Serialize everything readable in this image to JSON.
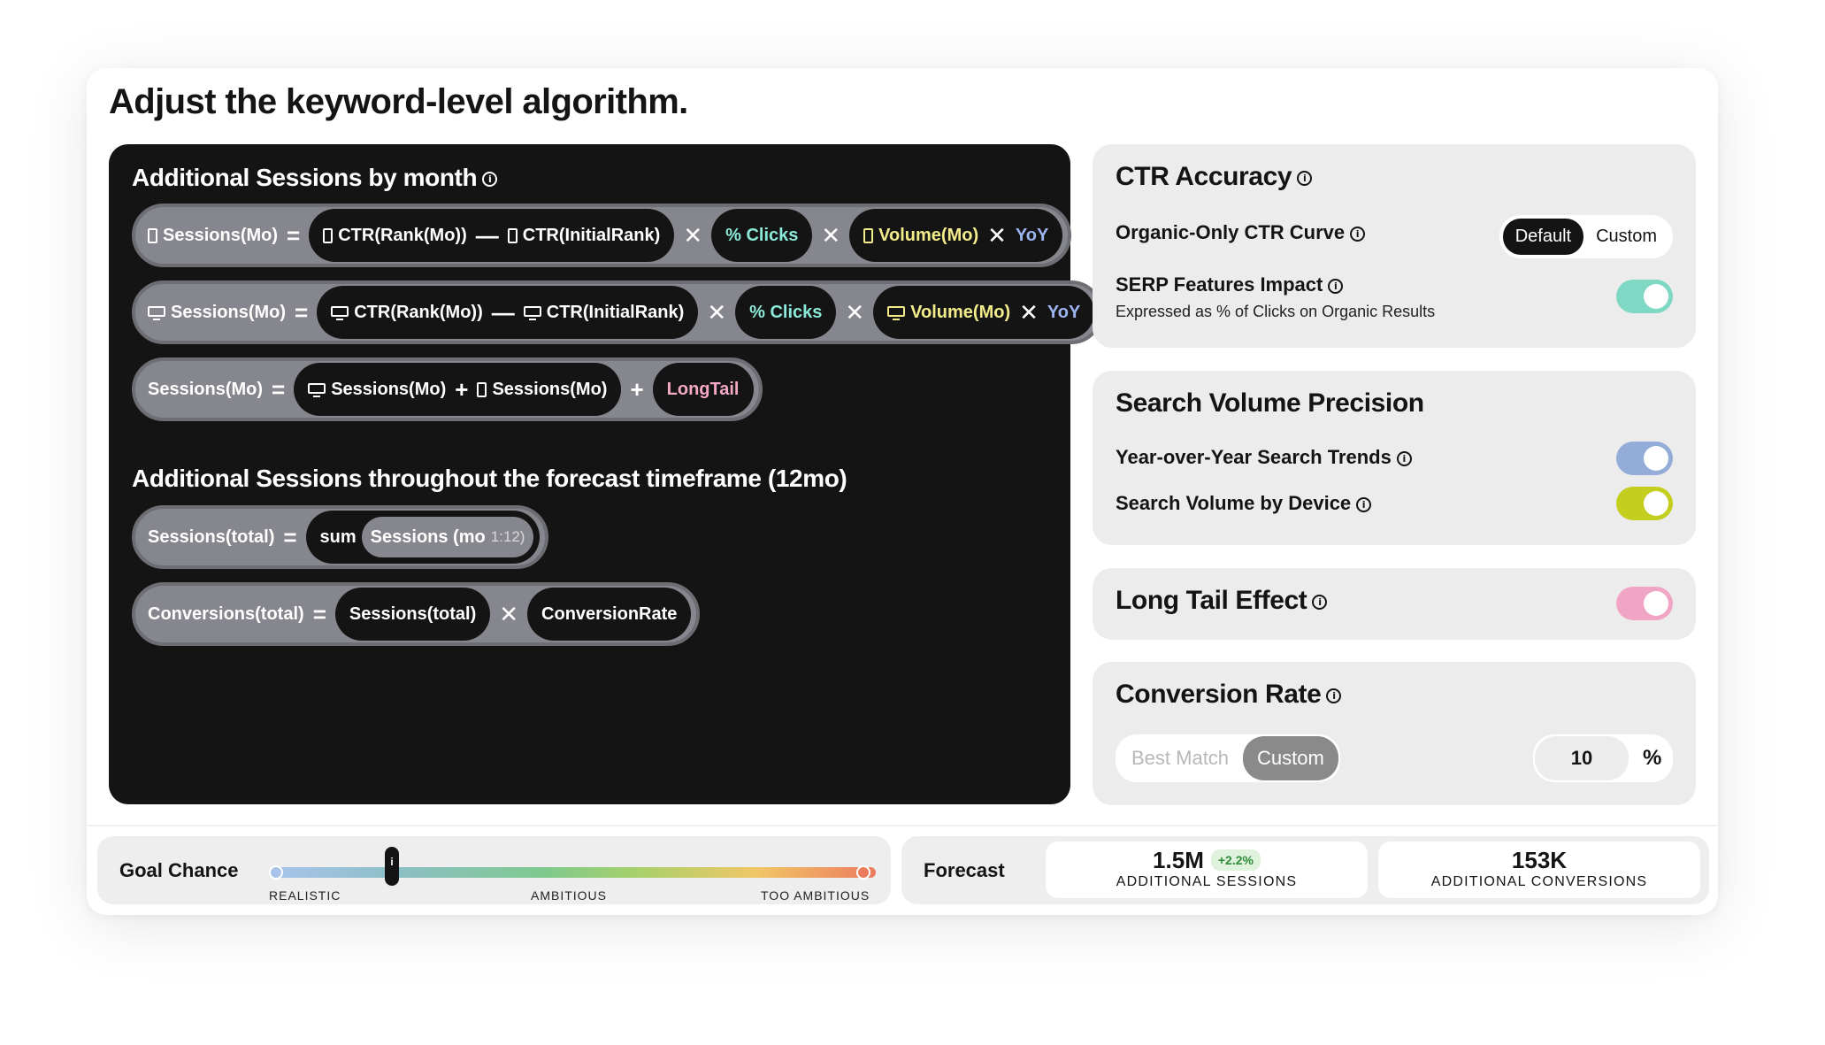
{
  "title": "Adjust the keyword-level algorithm.",
  "left_panel": {
    "monthly_heading": "Additional Sessions by month",
    "f1": {
      "lhs": "Sessions(Mo)",
      "eq": "=",
      "t1": "CTR(Rank(Mo))",
      "minus": "—",
      "t2": "CTR(InitialRank)",
      "x1": "✕",
      "clicks": "% Clicks",
      "x2": "✕",
      "volume": "Volume(Mo)",
      "x3": "✕",
      "yoy": "YoY"
    },
    "f2": {
      "lhs": "Sessions(Mo)",
      "eq": "=",
      "t1": "CTR(Rank(Mo))",
      "minus": "—",
      "t2": "CTR(InitialRank)",
      "x1": "✕",
      "clicks": "% Clicks",
      "x2": "✕",
      "volume": "Volume(Mo)",
      "x3": "✕",
      "yoy": "YoY"
    },
    "f3": {
      "lhs": "Sessions(Mo)",
      "eq": "=",
      "desk": "Sessions(Mo)",
      "plus1": "+",
      "mobile": "Sessions(Mo)",
      "plus2": "+",
      "longtail": "LongTail"
    },
    "total_heading": "Additional Sessions throughout the forecast timeframe (12mo)",
    "f4": {
      "lhs": "Sessions(total)",
      "eq": "=",
      "sum": "sum",
      "inner": "Sessions (mo",
      "range": "1:12)"
    },
    "f5": {
      "lhs": "Conversions(total)",
      "eq": "=",
      "a": "Sessions(total)",
      "x": "✕",
      "b": "ConversionRate"
    }
  },
  "ctr": {
    "heading": "CTR Accuracy",
    "curve_label": "Organic-Only CTR Curve",
    "seg": [
      "Default",
      "Custom"
    ],
    "serp_label": "SERP Features Impact",
    "serp_sub": "Expressed as % of Clicks on Organic Results"
  },
  "volume": {
    "heading": "Search Volume Precision",
    "yoy_label": "Year-over-Year Search Trends",
    "device_label": "Search Volume by Device"
  },
  "longtail": {
    "heading": "Long Tail Effect"
  },
  "conversion": {
    "heading": "Conversion Rate",
    "seg": [
      "Best Match",
      "Custom"
    ],
    "value": "10",
    "unit": "%"
  },
  "goal": {
    "label": "Goal Chance",
    "marker": "i",
    "levels": [
      "REALISTIC",
      "AMBITIOUS",
      "TOO AMBITIOUS"
    ]
  },
  "forecast": {
    "label": "Forecast",
    "sessions": "1.5M",
    "sessions_change": "+2.2%",
    "sessions_caption": "ADDITIONAL SESSIONS",
    "conversions": "153K",
    "conversions_caption": "ADDITIONAL CONVERSIONS"
  },
  "colors": {
    "serp_toggle": "#7fd8c4",
    "yoy_toggle": "#93acd8",
    "device_toggle": "#c4ce1e",
    "longtail_toggle": "#f1a5c4"
  }
}
